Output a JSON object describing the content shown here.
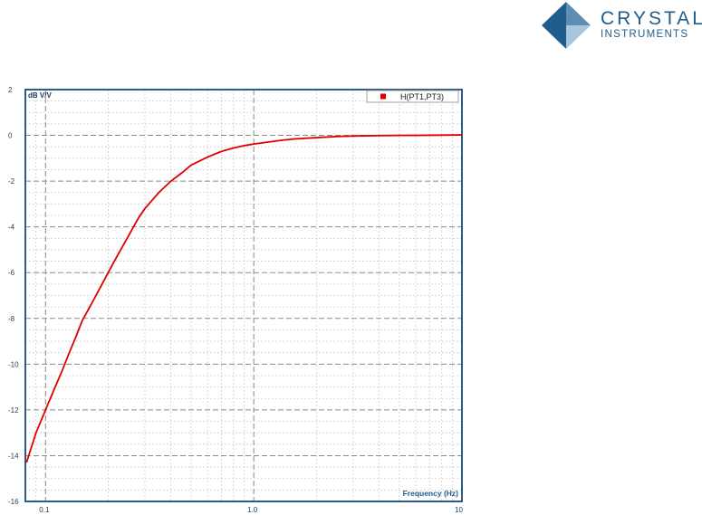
{
  "logo": {
    "name": "CRYSTAL",
    "subtitle": "INSTRUMENTS",
    "colors": [
      "#1e5d8c",
      "#5d8db3",
      "#a7c5dc"
    ]
  },
  "chart_data": {
    "type": "line",
    "x_scale": "log",
    "xlim": [
      0.08,
      10
    ],
    "ylim": [
      -16,
      2
    ],
    "yticks": [
      2,
      0,
      -2,
      -4,
      -6,
      -8,
      -10,
      -12,
      -14,
      -16
    ],
    "ytick_labels": [
      "2",
      "0",
      "-2",
      "-4",
      "-6",
      "-8",
      "-10",
      "-12",
      "-14",
      "-16"
    ],
    "xticks": [
      0.1,
      1,
      10
    ],
    "xtick_labels": [
      "0.1",
      "1.0",
      "10"
    ],
    "ylabel": "dB V/V",
    "xlabel": "Frequency (Hz)",
    "grid": true,
    "legend_position": "top-right",
    "colors": {
      "border": "#2b5b86",
      "major_grid": "#8a8a8a",
      "minor_grid": "#cfcfcf",
      "series": "#e00000"
    },
    "series": [
      {
        "name": "H(PT1,PT3)",
        "color": "#e00000",
        "x": [
          0.081,
          0.09,
          0.1,
          0.11,
          0.12,
          0.13,
          0.14,
          0.15,
          0.17,
          0.2,
          0.22,
          0.25,
          0.28,
          0.3,
          0.35,
          0.4,
          0.45,
          0.5,
          0.6,
          0.7,
          0.8,
          0.9,
          1.0,
          1.2,
          1.4,
          1.6,
          2.0,
          2.5,
          3.0,
          4.0,
          5.0,
          6.0,
          8.0,
          10.0
        ],
        "y": [
          -14.3,
          -13.0,
          -12.0,
          -11.1,
          -10.3,
          -9.5,
          -8.8,
          -8.1,
          -7.2,
          -6.0,
          -5.3,
          -4.4,
          -3.6,
          -3.2,
          -2.5,
          -2.0,
          -1.65,
          -1.3,
          -0.95,
          -0.7,
          -0.55,
          -0.45,
          -0.38,
          -0.28,
          -0.2,
          -0.15,
          -0.1,
          -0.05,
          -0.03,
          -0.01,
          0.0,
          0.0,
          0.01,
          0.02
        ]
      }
    ]
  }
}
